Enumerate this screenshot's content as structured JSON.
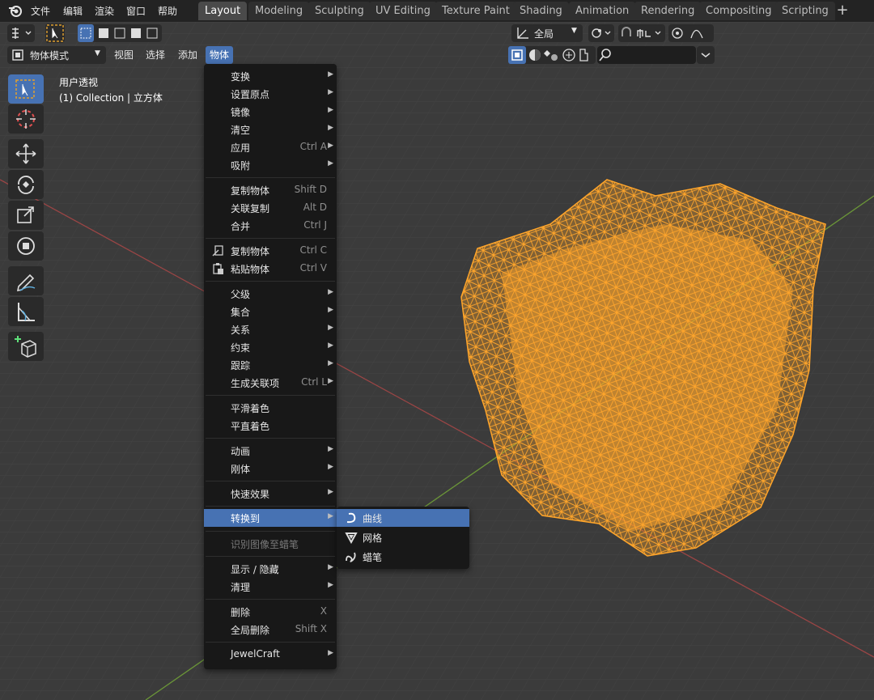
{
  "top_menu": [
    "文件",
    "编辑",
    "渲染",
    "窗口",
    "帮助"
  ],
  "workspace_tabs": [
    "Layout",
    "Modeling",
    "Sculpting",
    "UV Editing",
    "Texture Paint",
    "Shading",
    "Animation",
    "Rendering",
    "Compositing",
    "Scripting"
  ],
  "active_workspace": "Layout",
  "header": {
    "mode": "物体模式",
    "menus": [
      "视图",
      "选择",
      "添加",
      "物体"
    ],
    "active_menu": "物体",
    "transform_orientation": "全局",
    "search_placeholder": ""
  },
  "overlay": {
    "view_name": "用户透视",
    "collection": "(1) Collection | 立方体"
  },
  "object_menu": {
    "items": [
      {
        "label": "变换",
        "submenu": true
      },
      {
        "label": "设置原点",
        "submenu": true
      },
      {
        "label": "镜像",
        "submenu": true
      },
      {
        "label": "清空",
        "submenu": true
      },
      {
        "label": "应用",
        "shortcut": "Ctrl A",
        "submenu": true
      },
      {
        "label": "吸附",
        "submenu": true
      },
      {
        "label": "复制物体",
        "shortcut": "Shift D"
      },
      {
        "label": "关联复制",
        "shortcut": "Alt D"
      },
      {
        "label": "合并",
        "shortcut": "Ctrl J"
      },
      {
        "label": "复制物体",
        "shortcut": "Ctrl C",
        "icon": "copy-icon"
      },
      {
        "label": "粘贴物体",
        "shortcut": "Ctrl V",
        "icon": "paste-icon"
      },
      {
        "label": "父级",
        "submenu": true
      },
      {
        "label": "集合",
        "submenu": true
      },
      {
        "label": "关系",
        "submenu": true
      },
      {
        "label": "约束",
        "submenu": true
      },
      {
        "label": "跟踪",
        "submenu": true
      },
      {
        "label": "生成关联项",
        "shortcut": "Ctrl L",
        "submenu": true
      },
      {
        "label": "平滑着色"
      },
      {
        "label": "平直着色"
      },
      {
        "label": "动画",
        "submenu": true
      },
      {
        "label": "刚体",
        "submenu": true
      },
      {
        "label": "快速效果",
        "submenu": true
      },
      {
        "label": "转换到",
        "submenu": true,
        "highlighted": true
      },
      {
        "label": "识别图像至蜡笔",
        "disabled": true
      },
      {
        "label": "显示 / 隐藏",
        "submenu": true
      },
      {
        "label": "清理",
        "submenu": true
      },
      {
        "label": "删除",
        "shortcut": "X"
      },
      {
        "label": "全局删除",
        "shortcut": "Shift X"
      },
      {
        "label": "JewelCraft",
        "submenu": true
      }
    ]
  },
  "convert_submenu": {
    "items": [
      {
        "label": "曲线",
        "icon": "curve-icon",
        "highlighted": true
      },
      {
        "label": "网格",
        "icon": "mesh-icon"
      },
      {
        "label": "蜡笔",
        "icon": "grease-pencil-icon"
      }
    ]
  },
  "colors": {
    "accent": "#4772b3",
    "wireframe": "#ffa52b",
    "background": "#3b3b3b",
    "menu_bg": "#181818",
    "x_axis": "#b04a4a",
    "y_axis": "#6e9a3a"
  }
}
